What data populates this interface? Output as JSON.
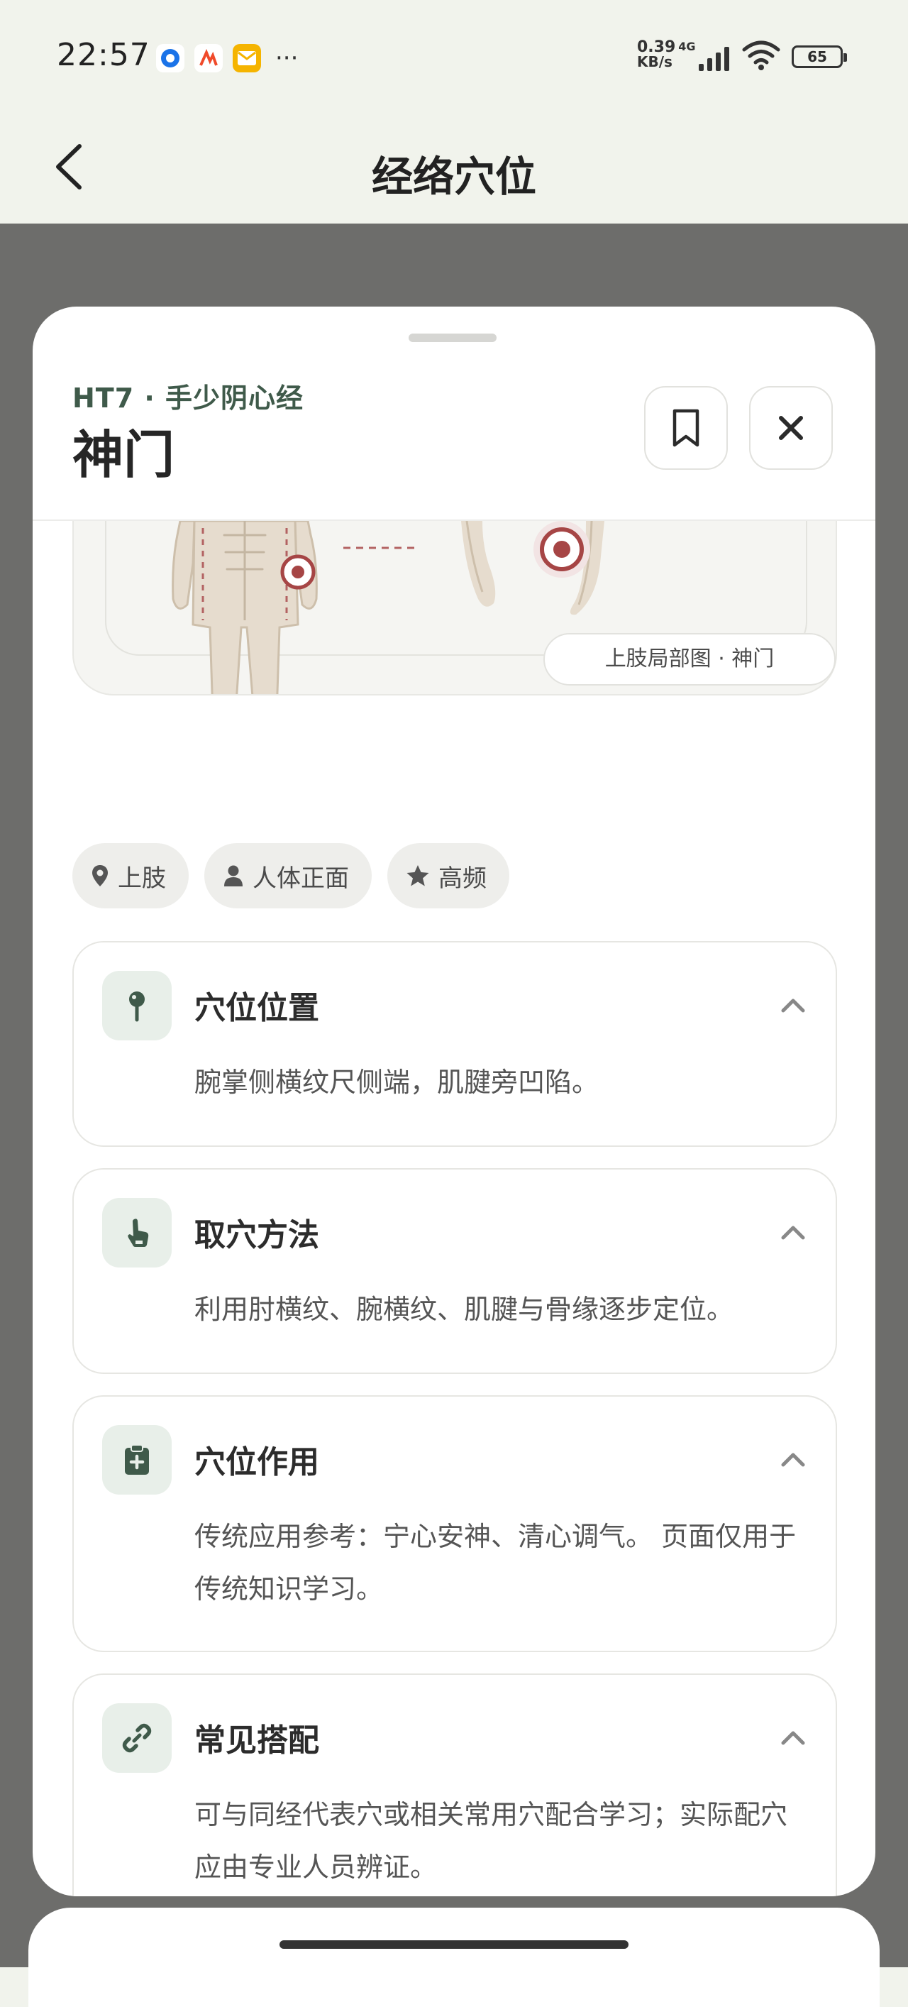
{
  "status": {
    "time": "22:57",
    "net_speed": "0.39",
    "net_unit": "KB/s",
    "net_type": "4G",
    "battery": "65"
  },
  "nav": {
    "title": "经络穴位"
  },
  "sheet": {
    "code": "HT7 · 手少阴心经",
    "name": "神门",
    "illustration_caption": "上肢局部图 · 神门",
    "chips": [
      "上肢",
      "人体正面",
      "高频"
    ],
    "cards": [
      {
        "title": "穴位位置",
        "body": "腕掌侧横纹尺侧端，肌腱旁凹陷。",
        "icon": "pin-icon"
      },
      {
        "title": "取穴方法",
        "body": "利用肘横纹、腕横纹、肌腱与骨缘逐步定位。",
        "icon": "hand-pointer-icon"
      },
      {
        "title": "穴位作用",
        "body": "传统应用参考：宁心安神、清心调气。 页面仅用于传统知识学习。",
        "icon": "clipboard-medical-icon"
      },
      {
        "title": "常见搭配",
        "body": "可与同经代表穴或相关常用穴配合学习；实际配穴应由专业人员辨证。",
        "icon": "link-icon"
      }
    ]
  },
  "colors": {
    "accent": "#3f5a4a",
    "marker": "#a64545",
    "skin": "#e6dcce"
  }
}
